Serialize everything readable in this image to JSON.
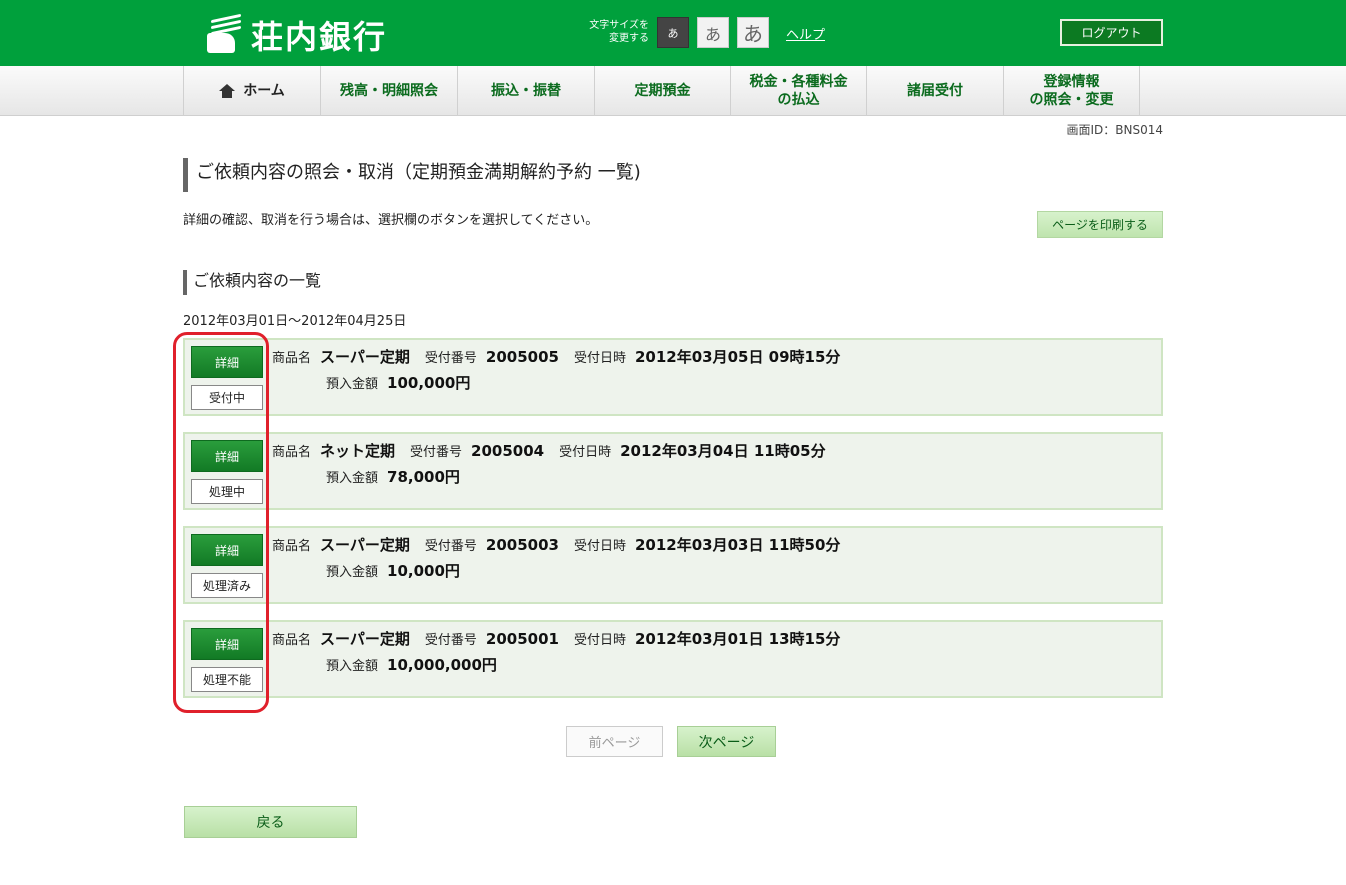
{
  "header": {
    "logo_text": "荘内銀行",
    "fontsize_label_line1": "文字サイズを",
    "fontsize_label_line2": "変更する",
    "fontsize_small": "あ",
    "fontsize_medium": "あ",
    "fontsize_large": "あ",
    "help": "ヘルプ",
    "logout": "ログアウト"
  },
  "nav": {
    "items": [
      {
        "label": "ホーム"
      },
      {
        "label": "残高・明細照会"
      },
      {
        "label": "振込・振替"
      },
      {
        "label": "定期預金"
      },
      {
        "label_line1": "税金・各種料金",
        "label_line2": "の払込"
      },
      {
        "label": "諸届受付"
      },
      {
        "label_line1": "登録情報",
        "label_line2": "の照会・変更"
      }
    ]
  },
  "screen_id": "画面ID：BNS014",
  "page": {
    "title": "ご依頼内容の照会・取消（定期預金満期解約予約 一覧)",
    "instructions": "詳細の確認、取消を行う場合は、選択欄のボタンを選択してください。",
    "print_button": "ページを印刷する",
    "section_title": "ご依頼内容の一覧",
    "date_range": "2012年03月01日～2012年04月25日"
  },
  "labels": {
    "detail": "詳細",
    "product": "商品名",
    "receipt_no": "受付番号",
    "receipt_datetime": "受付日時",
    "amount": "預入金額"
  },
  "requests": [
    {
      "status": "受付中",
      "product": "スーパー定期",
      "receipt_no": "2005005",
      "datetime": "2012年03月05日 09時15分",
      "amount": "100,000円"
    },
    {
      "status": "処理中",
      "product": "ネット定期",
      "receipt_no": "2005004",
      "datetime": "2012年03月04日 11時05分",
      "amount": "78,000円"
    },
    {
      "status": "処理済み",
      "product": "スーパー定期",
      "receipt_no": "2005003",
      "datetime": "2012年03月03日 11時50分",
      "amount": "10,000円"
    },
    {
      "status": "処理不能",
      "product": "スーパー定期",
      "receipt_no": "2005001",
      "datetime": "2012年03月01日 13時15分",
      "amount": "10,000,000円"
    }
  ],
  "pagination": {
    "prev": "前ページ",
    "next": "次ページ"
  },
  "back_button": "戻る",
  "colors": {
    "brand_green": "#00a03c",
    "nav_text": "#0b6b1e",
    "highlight_red": "#e0202b",
    "card_bg": "#eef3ec"
  }
}
